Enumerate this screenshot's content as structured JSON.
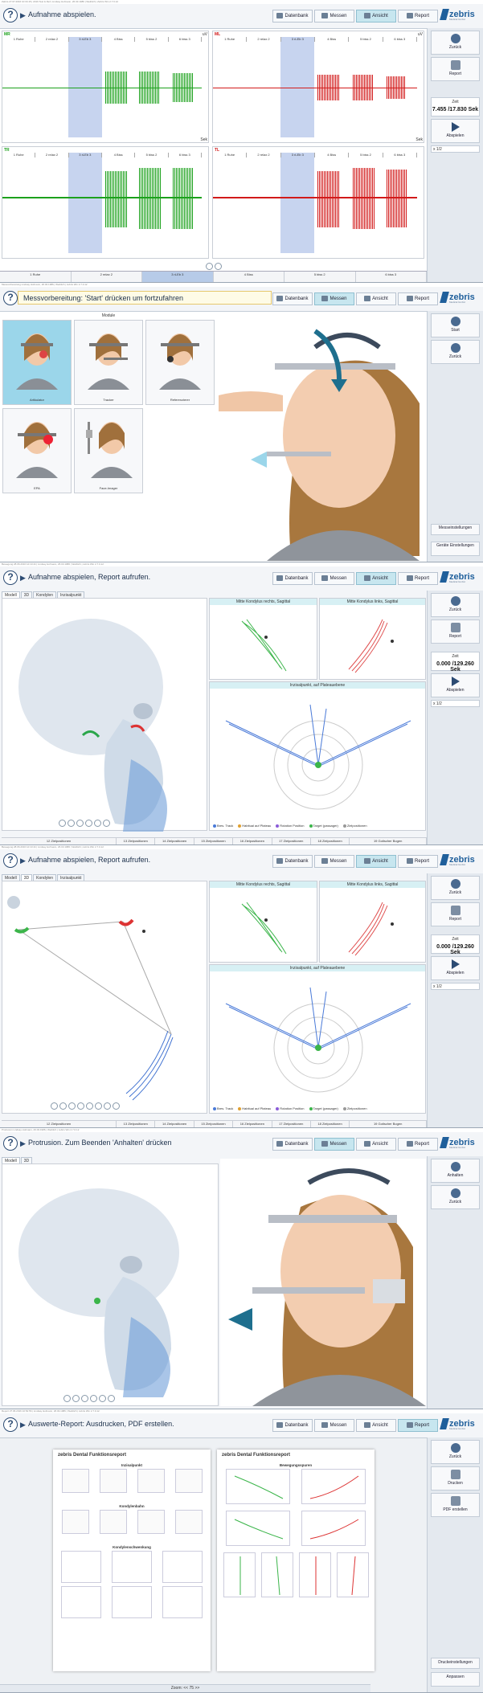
{
  "nav": {
    "datenbank": "Datenbank",
    "messen": "Messen",
    "ansicht": "Ansicht",
    "report": "Report"
  },
  "logo": {
    "name": "zebris",
    "sub": "Medical GmbH"
  },
  "screens": {
    "s1": {
      "title": "Zebris  27.07.2016 10:34:15 | 2016 Test & Ref | Lindsay Hofmann, 26.03.1986 | Weiblich | Zebris Win 2.7.0.12",
      "prompt": "Aufnahme abspielen.",
      "side": {
        "back": "Zurück",
        "report": "Report",
        "time_label": "Zeit",
        "time_value": "7.455 /17.830 Sek",
        "play": "Abspielen",
        "speed": "x 1/2"
      },
      "channels": [
        {
          "label": "MR",
          "color": "#1ca11c"
        },
        {
          "label": "ML",
          "color": "#d21a1a"
        },
        {
          "label": "TR",
          "color": "#1ca11c"
        },
        {
          "label": "TL",
          "color": "#d21a1a"
        }
      ],
      "segments": [
        "1 Ruhe",
        "2 relax 2",
        "3 rLEb 3",
        "4 Biss",
        "5 biss 2",
        "6 biss 3"
      ],
      "unit_uv": "uV",
      "unit_sek": "Sek",
      "timeline": [
        "1 Ruhe",
        "2 relax 2",
        "3 rLEb 3",
        "4 Biss",
        "5 biss 2",
        "6 biss 3"
      ]
    },
    "s2": {
      "title": "Messvorbereitung  Lindsay Hofmann, 26.03.1986 | Weiblich | zebris Win 2.7.0.12",
      "prompt": "Messvorbereitung: 'Start' drücken um fortzufahren",
      "modules_title": "Module",
      "modules": [
        "Artikulator",
        "Tracker",
        "Referenzierer",
        "EPA",
        "Face-Imager"
      ],
      "side": {
        "start": "Start",
        "back": "Zurück",
        "settings1": "Messeinstellungen",
        "settings2": "Geräte Einstellungen"
      }
    },
    "s3": {
      "title": "Bewegung  28.06.2016 12:19:44 | Lindsay Hofmann, 26.03.1986 | Weiblich | zebris Win 2.7.0.12",
      "prompt": "Aufnahme abspielen, Report aufrufen.",
      "subtabs": [
        "Modell",
        "3D",
        "Kondylen",
        "Inzisalpunkt"
      ],
      "panel_right_sag": "Mitte Kondylus rechts, Sagittal",
      "panel_left_sag": "Mitte Kondylus links, Sagittal",
      "panel_incisal": "Inzisalpunkt, auf Plateauebene",
      "legend": [
        "Bres. Track",
        "Habitual auf Plateau",
        "Rotation Position",
        "Target (passager)",
        "Zielpositionen"
      ],
      "side": {
        "back": "Zurück",
        "report": "Report",
        "time_label": "Zeit",
        "time_value": "0.000 /129.260 Sek",
        "play": "Abspielen",
        "speed": "x 1/2"
      },
      "strip": [
        "12 Zielpositionen",
        "13 Zielpositionen",
        "14 Zielpositionen",
        "15 Zielpositionen",
        "16 Zielpositionen",
        "17 Zielpositionen",
        "18 Zielpositionen",
        "19 Gotischer Bogen"
      ]
    },
    "s4": {
      "title": "Bewegung  28.06.2016 12:19:44 | Lindsay Hofmann, 26.03.1986 | Weiblich | zebris Win 2.7.0.12",
      "prompt": "Aufnahme abspielen, Report aufrufen.",
      "subtabs": [
        "Modell",
        "3D",
        "Kondylen",
        "Inzisalpunkt"
      ],
      "side": {
        "back": "Zurück",
        "report": "Report",
        "time_label": "Zeit",
        "time_value": "0.000 /129.260 Sek",
        "play": "Abspielen",
        "speed": "x 1/2"
      }
    },
    "s5": {
      "title": "Protrusion  Lindsay Hofmann, 26.03.1986 | Weiblich | zebris Win 2.7.0.12",
      "prompt": "Protrusion. Zum Beenden 'Anhalten' drücken",
      "subtabs": [
        "Modell",
        "3D"
      ],
      "side": {
        "stop": "Anhalten",
        "back": "Zurück"
      }
    },
    "s6": {
      "title": "Report  27.06.2016 10:52:56 | Lindsay Hofmann, 26.03.1986 | Weiblich | zebris Win 2.7.0.12",
      "prompt": "Auswerte-Report: Ausdrucken, PDF erstellen.",
      "page1": {
        "title": "zebris Dental Funktionsreport",
        "section1": "Inzisalpunkt",
        "section2": "Kondylenbahn",
        "section3": "Kondylenschwenkung"
      },
      "page2": {
        "title": "zebris Dental Funktionsreport",
        "section1": "Bewegungsspuren"
      },
      "side": {
        "back": "Zurück",
        "print": "Drucken",
        "pdf": "PDF erstellen",
        "settings": "Druckeinstellungen",
        "apply": "Anpassen"
      },
      "footer": "Zoom: <<  75  >>"
    }
  }
}
